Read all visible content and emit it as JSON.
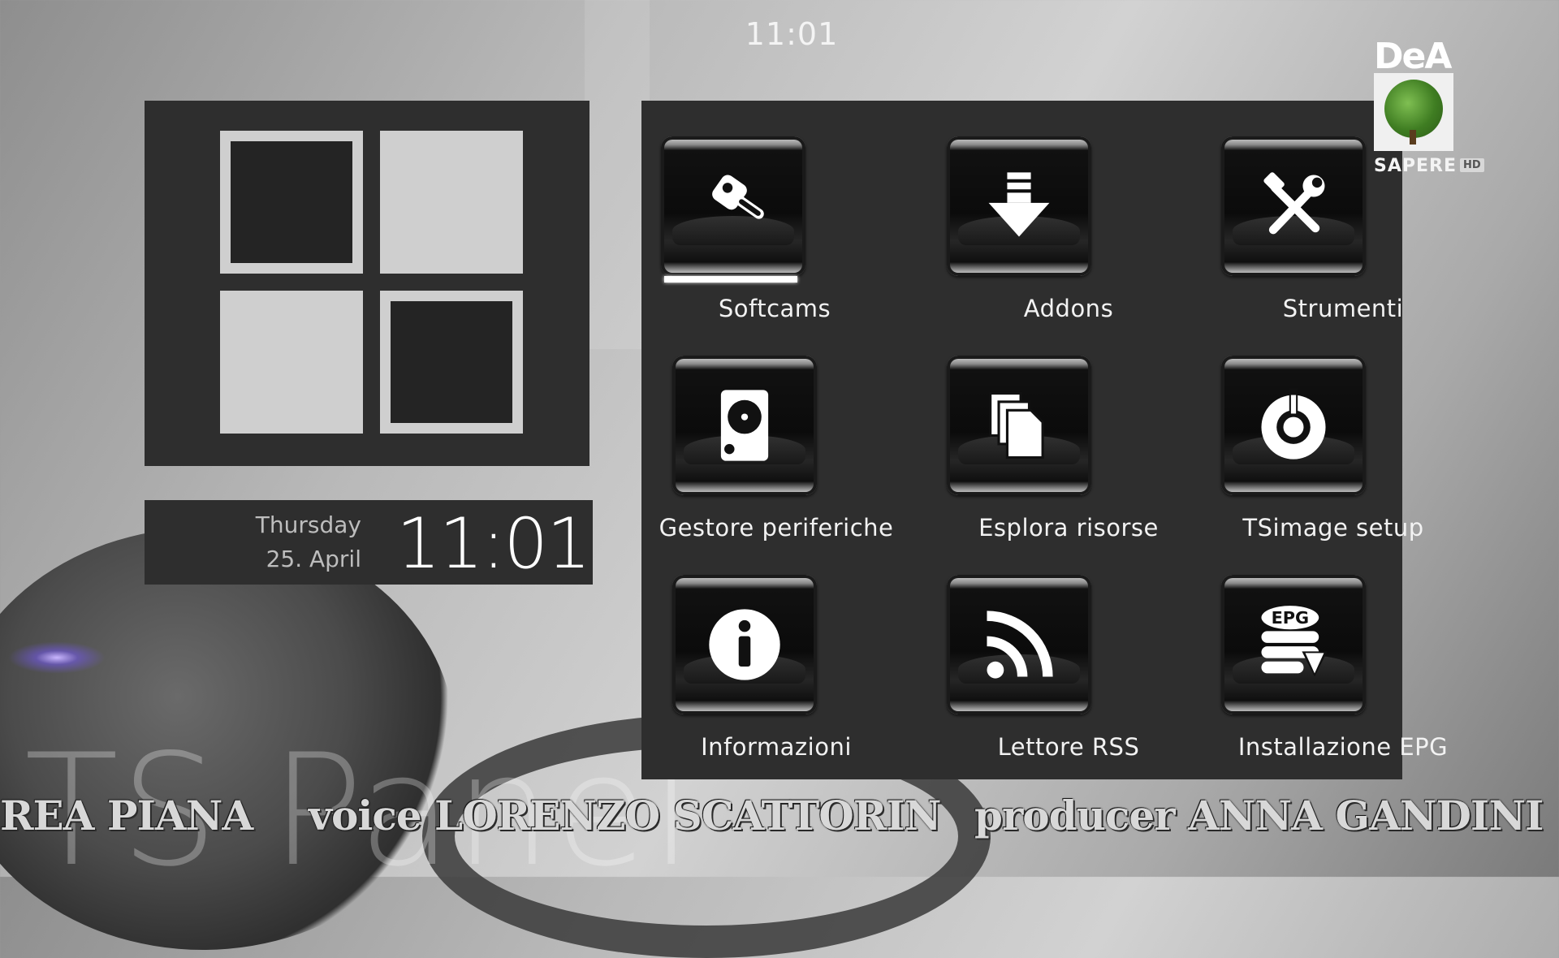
{
  "clock": {
    "time": "11:01"
  },
  "info_panel": {
    "day": "Thursday",
    "date": "25. April",
    "time": "11:01"
  },
  "menu": {
    "selected": "Softcams",
    "items": [
      {
        "label": "Softcams",
        "icon": "key-icon"
      },
      {
        "label": "Addons",
        "icon": "download-icon"
      },
      {
        "label": "Strumenti",
        "icon": "tools-icon"
      },
      {
        "label": "Gestore periferiche",
        "icon": "hard-drive-icon"
      },
      {
        "label": "Esplora risorse",
        "icon": "files-icon"
      },
      {
        "label": "TSimage setup",
        "icon": "power-gear-icon"
      },
      {
        "label": "Informazioni",
        "icon": "info-icon"
      },
      {
        "label": "Lettore RSS",
        "icon": "rss-icon"
      },
      {
        "label": "Installazione EPG",
        "icon": "epg-icon"
      }
    ],
    "epg_icon_text": "EPG"
  },
  "channel_logo": {
    "brand": "DeA",
    "name": "SAPERE",
    "badge": "HD"
  },
  "watermark": "TS Panel",
  "credits": [
    "REA PIANA",
    "voice LORENZO SCATTORIN",
    "producer ANNA GANDINI"
  ],
  "colors": {
    "panel": "#2e2e2e",
    "tile_light": "#cfcfcf",
    "text": "#f2f2f2"
  }
}
